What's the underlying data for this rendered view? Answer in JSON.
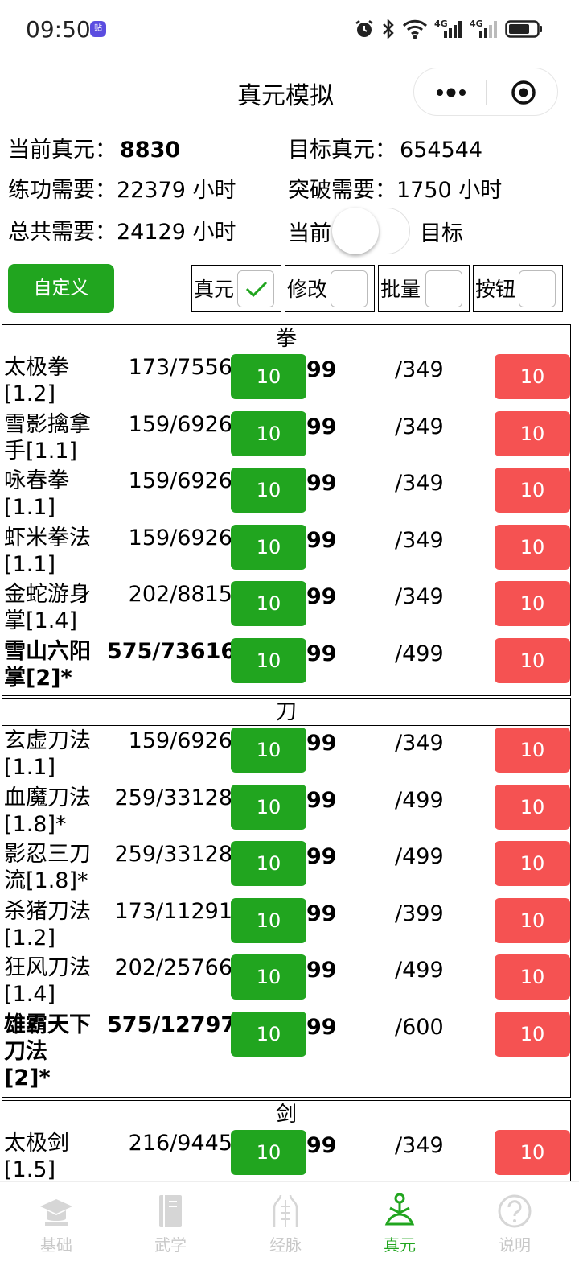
{
  "status_bar": {
    "time": "09:50",
    "network_a": "4G",
    "network_b": "4G"
  },
  "header": {
    "title": "真元模拟"
  },
  "summary": {
    "current_label": "当前真元：",
    "current_value": "8830",
    "target_label": "目标真元：",
    "target_value": "654544",
    "practice_text": "练功需要：22379 小时",
    "breakthrough_text": "突破需要：1750 小时",
    "total_text": "总共需要：24129 小时",
    "toggle_left": "当前",
    "toggle_right": "目标"
  },
  "controls": {
    "custom_button": "自定义",
    "options": [
      {
        "label": "真元",
        "checked": true
      },
      {
        "label": "修改",
        "checked": false
      },
      {
        "label": "批量",
        "checked": false
      },
      {
        "label": "按钮",
        "checked": false
      }
    ]
  },
  "sections": [
    {
      "title": "拳",
      "rows": [
        {
          "name": "太极拳[1.2]",
          "progress": "173/7556",
          "plus": "10",
          "level": "99",
          "max": "/349",
          "minus": "10",
          "bold": false
        },
        {
          "name": "雪影擒拿手[1.1]",
          "progress": "159/6926",
          "plus": "10",
          "level": "99",
          "max": "/349",
          "minus": "10",
          "bold": false
        },
        {
          "name": "咏春拳[1.1]",
          "progress": "159/6926",
          "plus": "10",
          "level": "99",
          "max": "/349",
          "minus": "10",
          "bold": false
        },
        {
          "name": "虾米拳法[1.1]",
          "progress": "159/6926",
          "plus": "10",
          "level": "99",
          "max": "/349",
          "minus": "10",
          "bold": false
        },
        {
          "name": "金蛇游身掌[1.4]",
          "progress": "202/8815",
          "plus": "10",
          "level": "99",
          "max": "/349",
          "minus": "10",
          "bold": false
        },
        {
          "name": "雪山六阳掌[2]*",
          "progress": "575/73616",
          "plus": "10",
          "level": "99",
          "max": "/499",
          "minus": "10",
          "bold": true
        }
      ]
    },
    {
      "title": "刀",
      "rows": [
        {
          "name": "玄虚刀法[1.1]",
          "progress": "159/6926",
          "plus": "10",
          "level": "99",
          "max": "/349",
          "minus": "10",
          "bold": false
        },
        {
          "name": "血魔刀法[1.8]*",
          "progress": "259/33128",
          "plus": "10",
          "level": "99",
          "max": "/499",
          "minus": "10",
          "bold": false
        },
        {
          "name": "影忍三刀流[1.8]*",
          "progress": "259/33128",
          "plus": "10",
          "level": "99",
          "max": "/499",
          "minus": "10",
          "bold": false
        },
        {
          "name": "杀猪刀法[1.2]",
          "progress": "173/11291",
          "plus": "10",
          "level": "99",
          "max": "/399",
          "minus": "10",
          "bold": false
        },
        {
          "name": "狂风刀法[1.4]",
          "progress": "202/25766",
          "plus": "10",
          "level": "99",
          "max": "/499",
          "minus": "10",
          "bold": false
        },
        {
          "name": "雄霸天下刀法[2]*",
          "progress": "575/127975",
          "plus": "10",
          "level": "99",
          "max": "/600",
          "minus": "10",
          "bold": true
        }
      ]
    },
    {
      "title": "剑",
      "rows": [
        {
          "name": "太极剑[1.5]",
          "progress": "216/9445",
          "plus": "10",
          "level": "99",
          "max": "/349",
          "minus": "10",
          "bold": false
        }
      ]
    }
  ],
  "tabbar": {
    "tabs": [
      {
        "label": "基础",
        "icon": "graduation-cap-icon",
        "active": false
      },
      {
        "label": "武学",
        "icon": "book-icon",
        "active": false
      },
      {
        "label": "经脉",
        "icon": "body-meridian-icon",
        "active": false
      },
      {
        "label": "真元",
        "icon": "meditation-icon",
        "active": true
      },
      {
        "label": "说明",
        "icon": "question-icon",
        "active": false
      }
    ]
  },
  "colors": {
    "green": "#21a51f",
    "red": "#f55252"
  }
}
